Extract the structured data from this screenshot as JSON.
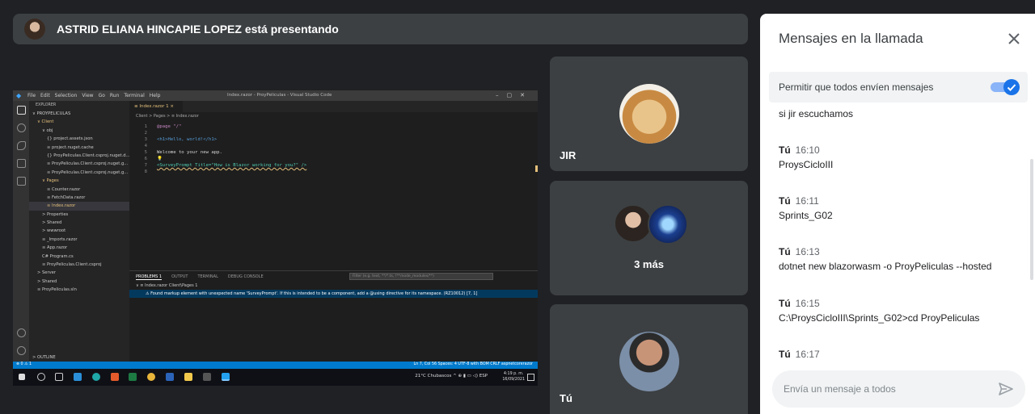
{
  "presenter": {
    "name": "ASTRID ELIANA HINCAPIE LOPEZ está presentando"
  },
  "screen": {
    "vscode_menu": [
      "File",
      "Edit",
      "Selection",
      "View",
      "Go",
      "Run",
      "Terminal",
      "Help"
    ],
    "window_title": "Index.razor - ProyPeliculas - Visual Studio Code",
    "explorer_header": "EXPLORER",
    "explorer_items": [
      {
        "label": "∨ PROYPELICULAS",
        "indent": 0,
        "type": "root"
      },
      {
        "label": "∨ Client",
        "indent": 1,
        "type": "folder"
      },
      {
        "label": "∨ obj",
        "indent": 2,
        "type": "plain"
      },
      {
        "label": "{} project.assets.json",
        "indent": 3,
        "type": "plain"
      },
      {
        "label": "≡ project.nuget.cache",
        "indent": 3,
        "type": "plain"
      },
      {
        "label": "{} ProyPeliculas.Client.csproj.nuget.d...",
        "indent": 3,
        "type": "plain"
      },
      {
        "label": "≡ ProyPeliculas.Client.csproj.nuget.g...",
        "indent": 3,
        "type": "plain"
      },
      {
        "label": "≡ ProyPeliculas.Client.csproj.nuget.g...",
        "indent": 3,
        "type": "plain"
      },
      {
        "label": "∨ Pages",
        "indent": 2,
        "type": "folder"
      },
      {
        "label": "≡ Counter.razor",
        "indent": 3,
        "type": "plain"
      },
      {
        "label": "≡ FetchData.razor",
        "indent": 3,
        "type": "plain"
      },
      {
        "label": "≡ Index.razor",
        "indent": 3,
        "type": "selected"
      },
      {
        "label": "> Properties",
        "indent": 2,
        "type": "plain"
      },
      {
        "label": "> Shared",
        "indent": 2,
        "type": "plain"
      },
      {
        "label": "> wwwroot",
        "indent": 2,
        "type": "plain"
      },
      {
        "label": "≡ _Imports.razor",
        "indent": 2,
        "type": "plain"
      },
      {
        "label": "≡ App.razor",
        "indent": 2,
        "type": "plain"
      },
      {
        "label": "C# Program.cs",
        "indent": 2,
        "type": "plain"
      },
      {
        "label": "≡ ProyPeliculas.Client.csproj",
        "indent": 2,
        "type": "plain"
      },
      {
        "label": "> Server",
        "indent": 1,
        "type": "plain"
      },
      {
        "label": "> Shared",
        "indent": 1,
        "type": "plain"
      },
      {
        "label": "≡ ProyPeliculas.sln",
        "indent": 1,
        "type": "plain"
      }
    ],
    "outline_label": "> OUTLINE",
    "tab_label": "≡ Index.razor 1 ×",
    "breadcrumb": "Client > Pages > ≡ Index.razor",
    "code_lines": [
      {
        "n": "1",
        "a": "@page \"/\"",
        "cls": "c-dir"
      },
      {
        "n": "2",
        "a": "",
        "cls": "c-txt"
      },
      {
        "n": "3",
        "a": "<h1>Hello, world!</h1>",
        "cls": "c-tag"
      },
      {
        "n": "4",
        "a": "",
        "cls": "c-txt"
      },
      {
        "n": "5",
        "a": "Welcome to your new app.",
        "cls": "c-txt"
      },
      {
        "n": "6",
        "a": "💡",
        "cls": "c-txt"
      },
      {
        "n": "7",
        "a": "<SurveyPrompt Title=\"How is Blazor working for you?\" />",
        "cls": "c-warn"
      },
      {
        "n": "8",
        "a": "",
        "cls": "c-txt"
      }
    ],
    "panel_tabs": [
      "PROBLEMS 1",
      "OUTPUT",
      "TERMINAL",
      "DEBUG CONSOLE"
    ],
    "panel_filter": "Filter (e.g. text, **/*.ts, !**/node_modules/**)",
    "problem_file": "∨ ≡ Index.razor  Client\\Pages  1",
    "problem_message": "⚠ Found markup element with unexpected name 'SurveyPrompt'. If this is intended to be a component, add a @using directive for its namespace. (RZ10012) [7, 1]",
    "status_left": "⊗ 0 ⚠ 1",
    "status_right": "Ln 7, Col 56   Spaces: 4   UTF-8 with BOM   CRLF   aspnetcorerazor",
    "taskbar_weather": "21°C  Chubascos  ^ ⊕ ▮ ▭ ◁) ESP",
    "taskbar_time": "4:19 p. m.",
    "taskbar_date": "16/09/2021"
  },
  "tiles": [
    {
      "name": "JIR"
    },
    {
      "name": "3 más"
    },
    {
      "name": "Tú"
    }
  ],
  "chat": {
    "title": "Mensajes en la llamada",
    "allow_label": "Permitir que todos envíen mensajes",
    "allow_enabled": true,
    "partial_top": "si jir escuchamos",
    "messages": [
      {
        "sender": "Tú",
        "time": "16:10",
        "text": "ProysCicloIII"
      },
      {
        "sender": "Tú",
        "time": "16:11",
        "text": "Sprints_G02"
      },
      {
        "sender": "Tú",
        "time": "16:13",
        "text": "dotnet new blazorwasm -o ProyPeliculas --hosted"
      },
      {
        "sender": "Tú",
        "time": "16:15",
        "text": "C:\\ProysCicloIII\\Sprints_G02>cd ProyPeliculas"
      },
      {
        "sender": "Tú",
        "time": "16:17",
        "text": ""
      }
    ],
    "input_placeholder": "Envía un mensaje a todos"
  },
  "colors": {
    "accent": "#1a73e8",
    "meet_dark": "#202124",
    "tile": "#3c4043",
    "vscode_blue": "#007acc"
  }
}
